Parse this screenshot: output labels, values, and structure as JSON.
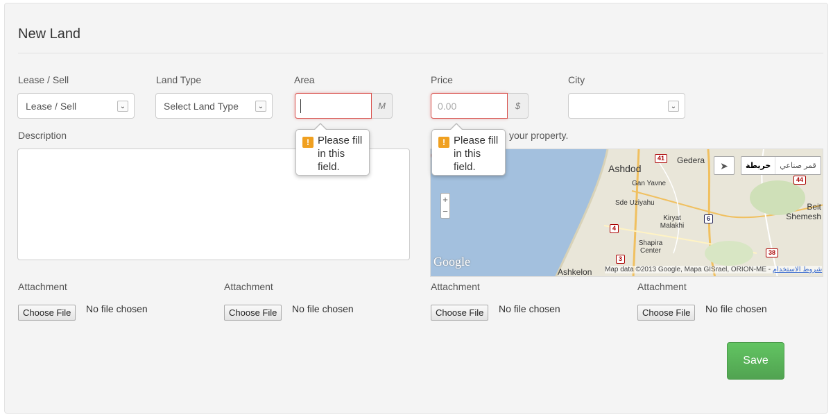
{
  "form": {
    "title": "New Land",
    "lease_sell": {
      "label": "Lease / Sell",
      "selected": "Lease / Sell"
    },
    "land_type": {
      "label": "Land Type",
      "selected": "Select Land Type"
    },
    "area": {
      "label": "Area",
      "value": "",
      "unit": "M"
    },
    "price": {
      "label": "Price",
      "placeholder": "0.00",
      "unit": "$"
    },
    "city": {
      "label": "City",
      "selected": ""
    },
    "description": {
      "label": "Description",
      "value": ""
    },
    "map_hint": "your property.",
    "validation_message": "Please fill in this field.",
    "attachments": [
      {
        "label": "Attachment",
        "button": "Choose File",
        "status": "No file chosen"
      },
      {
        "label": "Attachment",
        "button": "Choose File",
        "status": "No file chosen"
      },
      {
        "label": "Attachment",
        "button": "Choose File",
        "status": "No file chosen"
      },
      {
        "label": "Attachment",
        "button": "Choose File",
        "status": "No file chosen"
      }
    ],
    "save_label": "Save"
  },
  "map": {
    "type_map": "خريطة",
    "type_satellite": "قمر صناعي",
    "places": [
      "Ashdod",
      "Gedera",
      "Gan Yavne",
      "Sde Uziyahu",
      "Beit Shemesh",
      "Kiryat Malakhi",
      "Shapira Center",
      "Ashkelon"
    ],
    "roads": [
      "41",
      "44",
      "6",
      "4",
      "3",
      "38"
    ],
    "logo": "Google",
    "attribution": "Map data ©2013 Google, Mapa GISrael, ORION-ME -",
    "terms_link": "شروط الاستخدام",
    "zoom_in": "+",
    "zoom_out": "−"
  },
  "icons": {
    "caret": "chevron-down-icon",
    "warning": "warning-icon",
    "marker": "map-marker-icon",
    "location": "location-arrow-icon"
  },
  "colors": {
    "error_border": "#d9534f",
    "save_button": "#5cb85c",
    "warning_badge": "#f0a020",
    "sea": "#a3c0de"
  }
}
